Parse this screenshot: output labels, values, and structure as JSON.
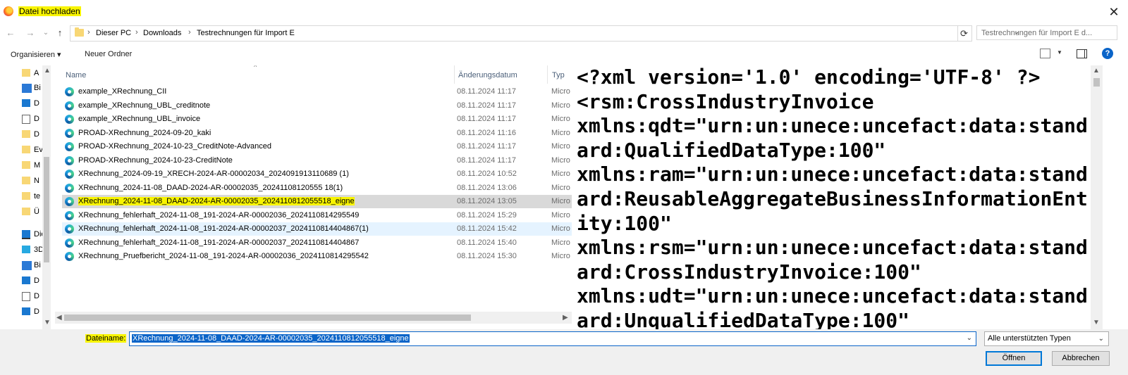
{
  "window": {
    "title": "Datei hochladen",
    "close_icon": "close-icon",
    "brand_icon": "firefox-logo"
  },
  "nav": {
    "back": "←",
    "forward": "→",
    "recent": "⌄",
    "up": "↑",
    "refresh": "⟳"
  },
  "address": {
    "crumbs": [
      "Dieser PC",
      "Downloads",
      "Testrechnungen für Import E"
    ]
  },
  "search": {
    "placeholder": "Testrechnungen für Import E d..."
  },
  "toolbar": {
    "organize": "Organisieren",
    "new_folder": "Neuer Ordner",
    "help": "?"
  },
  "navpane": {
    "items": [
      {
        "label": "A",
        "icon": "folder"
      },
      {
        "label": "Bi",
        "icon": "bi"
      },
      {
        "label": "D",
        "icon": "desk"
      },
      {
        "label": "D",
        "icon": "doc"
      },
      {
        "label": "D",
        "icon": "folder"
      },
      {
        "label": "Ev",
        "icon": "folder"
      },
      {
        "label": "M",
        "icon": "folder"
      },
      {
        "label": "N",
        "icon": "folder"
      },
      {
        "label": "te",
        "icon": "folder"
      },
      {
        "label": "Ü",
        "icon": "folder"
      },
      {
        "label": "Die",
        "icon": "pc"
      },
      {
        "label": "3D",
        "icon": "obj"
      },
      {
        "label": "Bi",
        "icon": "bi"
      },
      {
        "label": "D",
        "icon": "desk"
      },
      {
        "label": "D",
        "icon": "doc"
      },
      {
        "label": "D",
        "icon": "dl"
      }
    ]
  },
  "columns": {
    "name": "Name",
    "date": "Änderungsdatum",
    "type": "Typ"
  },
  "files": [
    {
      "name": "example_XRechnung_CII",
      "date": "08.11.2024 11:17",
      "type": "Micro"
    },
    {
      "name": "example_XRechnung_UBL_creditnote",
      "date": "08.11.2024 11:17",
      "type": "Micro"
    },
    {
      "name": "example_XRechnung_UBL_invoice",
      "date": "08.11.2024 11:17",
      "type": "Micro"
    },
    {
      "name": "PROAD-XRechnung_2024-09-20_kaki",
      "date": "08.11.2024 11:16",
      "type": "Micro"
    },
    {
      "name": "PROAD-XRechnung_2024-10-23_CreditNote-Advanced",
      "date": "08.11.2024 11:17",
      "type": "Micro"
    },
    {
      "name": "PROAD-XRechnung_2024-10-23-CreditNote",
      "date": "08.11.2024 11:17",
      "type": "Micro"
    },
    {
      "name": "XRechnung_2024-09-19_XRECH-2024-AR-00002034_2024091913110689 (1)",
      "date": "08.11.2024 10:52",
      "type": "Micro"
    },
    {
      "name": "XRechnung_2024-11-08_DAAD-2024-AR-00002035_20241108120555 18(1)",
      "date": "08.11.2024 13:06",
      "type": "Micro"
    },
    {
      "name": "XRechnung_2024-11-08_DAAD-2024-AR-00002035_2024110812055518_eigne",
      "date": "08.11.2024 13:05",
      "type": "Micro"
    },
    {
      "name": "XRechnung_fehlerhaft_2024-11-08_191-2024-AR-00002036_2024110814295549",
      "date": "08.11.2024 15:29",
      "type": "Micro"
    },
    {
      "name": "XRechnung_fehlerhaft_2024-11-08_191-2024-AR-00002037_2024110814404867(1)",
      "date": "08.11.2024 15:42",
      "type": "Micro"
    },
    {
      "name": "XRechnung_fehlerhaft_2024-11-08_191-2024-AR-00002037_2024110814404867",
      "date": "08.11.2024 15:40",
      "type": "Micro"
    },
    {
      "name": "XRechnung_Pruefbericht_2024-11-08_191-2024-AR-00002036_2024110814295542",
      "date": "08.11.2024 15:30",
      "type": "Micro"
    }
  ],
  "selected_index": 8,
  "hover_index": 10,
  "preview": {
    "lines": [
      "<?xml version='1.0' encoding='UTF-8' ?>",
      "<rsm:CrossIndustryInvoice",
      "xmlns:qdt=\"urn:un:unece:uncefact:data:stand",
      "ard:QualifiedDataType:100\"",
      "xmlns:ram=\"urn:un:unece:uncefact:data:stand",
      "ard:ReusableAggregateBusinessInformationEnt",
      "ity:100\"",
      "xmlns:rsm=\"urn:un:unece:uncefact:data:stand",
      "ard:CrossIndustryInvoice:100\"",
      "xmlns:udt=\"urn:un:unece:uncefact:data:stand",
      "ard:UnqualifiedDataType:100\""
    ]
  },
  "bottom": {
    "filename_label": "Dateiname:",
    "filename_value": "XRechnung_2024-11-08_DAAD-2024-AR-00002035_2024110812055518_eigne",
    "filetype": "Alle unterstützten Typen",
    "open": "Öffnen",
    "cancel": "Abbrechen"
  },
  "colors": {
    "accent": "#0a64c8",
    "highlight": "#f8f400",
    "selection": "#d9d9d9"
  }
}
